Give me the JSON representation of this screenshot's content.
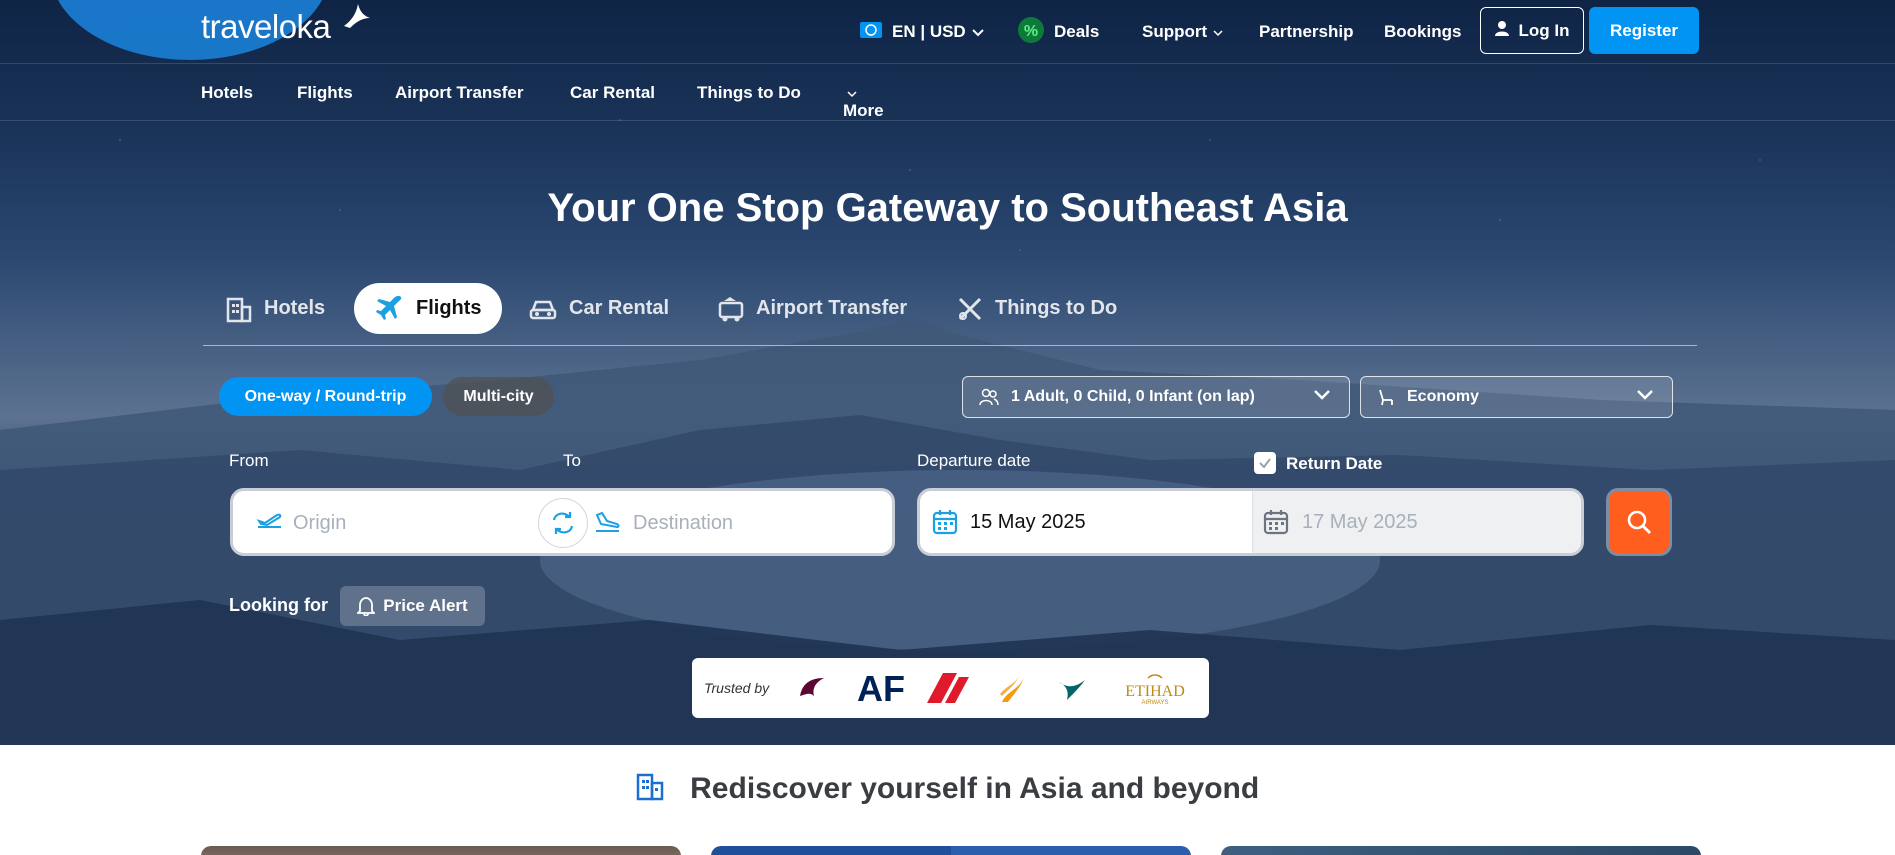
{
  "brand": {
    "name": "traveloka"
  },
  "header": {
    "language": "EN | USD",
    "deals": "Deals",
    "support": "Support",
    "partnership": "Partnership",
    "bookings": "Bookings",
    "login": "Log In",
    "register": "Register"
  },
  "subnav": {
    "items": [
      "Hotels",
      "Flights",
      "Airport Transfer",
      "Car Rental",
      "Things to Do",
      "More"
    ]
  },
  "hero": {
    "title": "Your One Stop Gateway to Southeast Asia"
  },
  "product_tabs": [
    "Hotels",
    "Flights",
    "Car Rental",
    "Airport Transfer",
    "Things to Do"
  ],
  "active_tab": "Flights",
  "trip_types": {
    "oneway_round": "One-way / Round-trip",
    "multi_city": "Multi-city"
  },
  "passengers": "1 Adult, 0 Child, 0 Infant (on lap)",
  "cabin_class": "Economy",
  "fields": {
    "from_label": "From",
    "to_label": "To",
    "origin_placeholder": "Origin",
    "destination_placeholder": "Destination",
    "departure_label": "Departure date",
    "departure_value": "15 May 2025",
    "return_label": "Return Date",
    "return_value": "17 May 2025",
    "return_checked": true
  },
  "looking_for": {
    "label": "Looking for",
    "price_alert": "Price Alert"
  },
  "trusted_by": {
    "label": "Trusted by",
    "airlines": [
      "qatar-airways",
      "air-france",
      "singapore-airlines",
      "cathay-pacific",
      "etihad-airways"
    ],
    "etihad_logo_text": "ETIHAD",
    "etihad_logo_sub": "AIRWAYS",
    "af_logo_text": "AF"
  },
  "section": {
    "title": "Rediscover yourself in Asia and beyond"
  },
  "colors": {
    "primary": "#0194f3",
    "search": "#ff5e1f",
    "hero_dark": "#1a3459"
  }
}
